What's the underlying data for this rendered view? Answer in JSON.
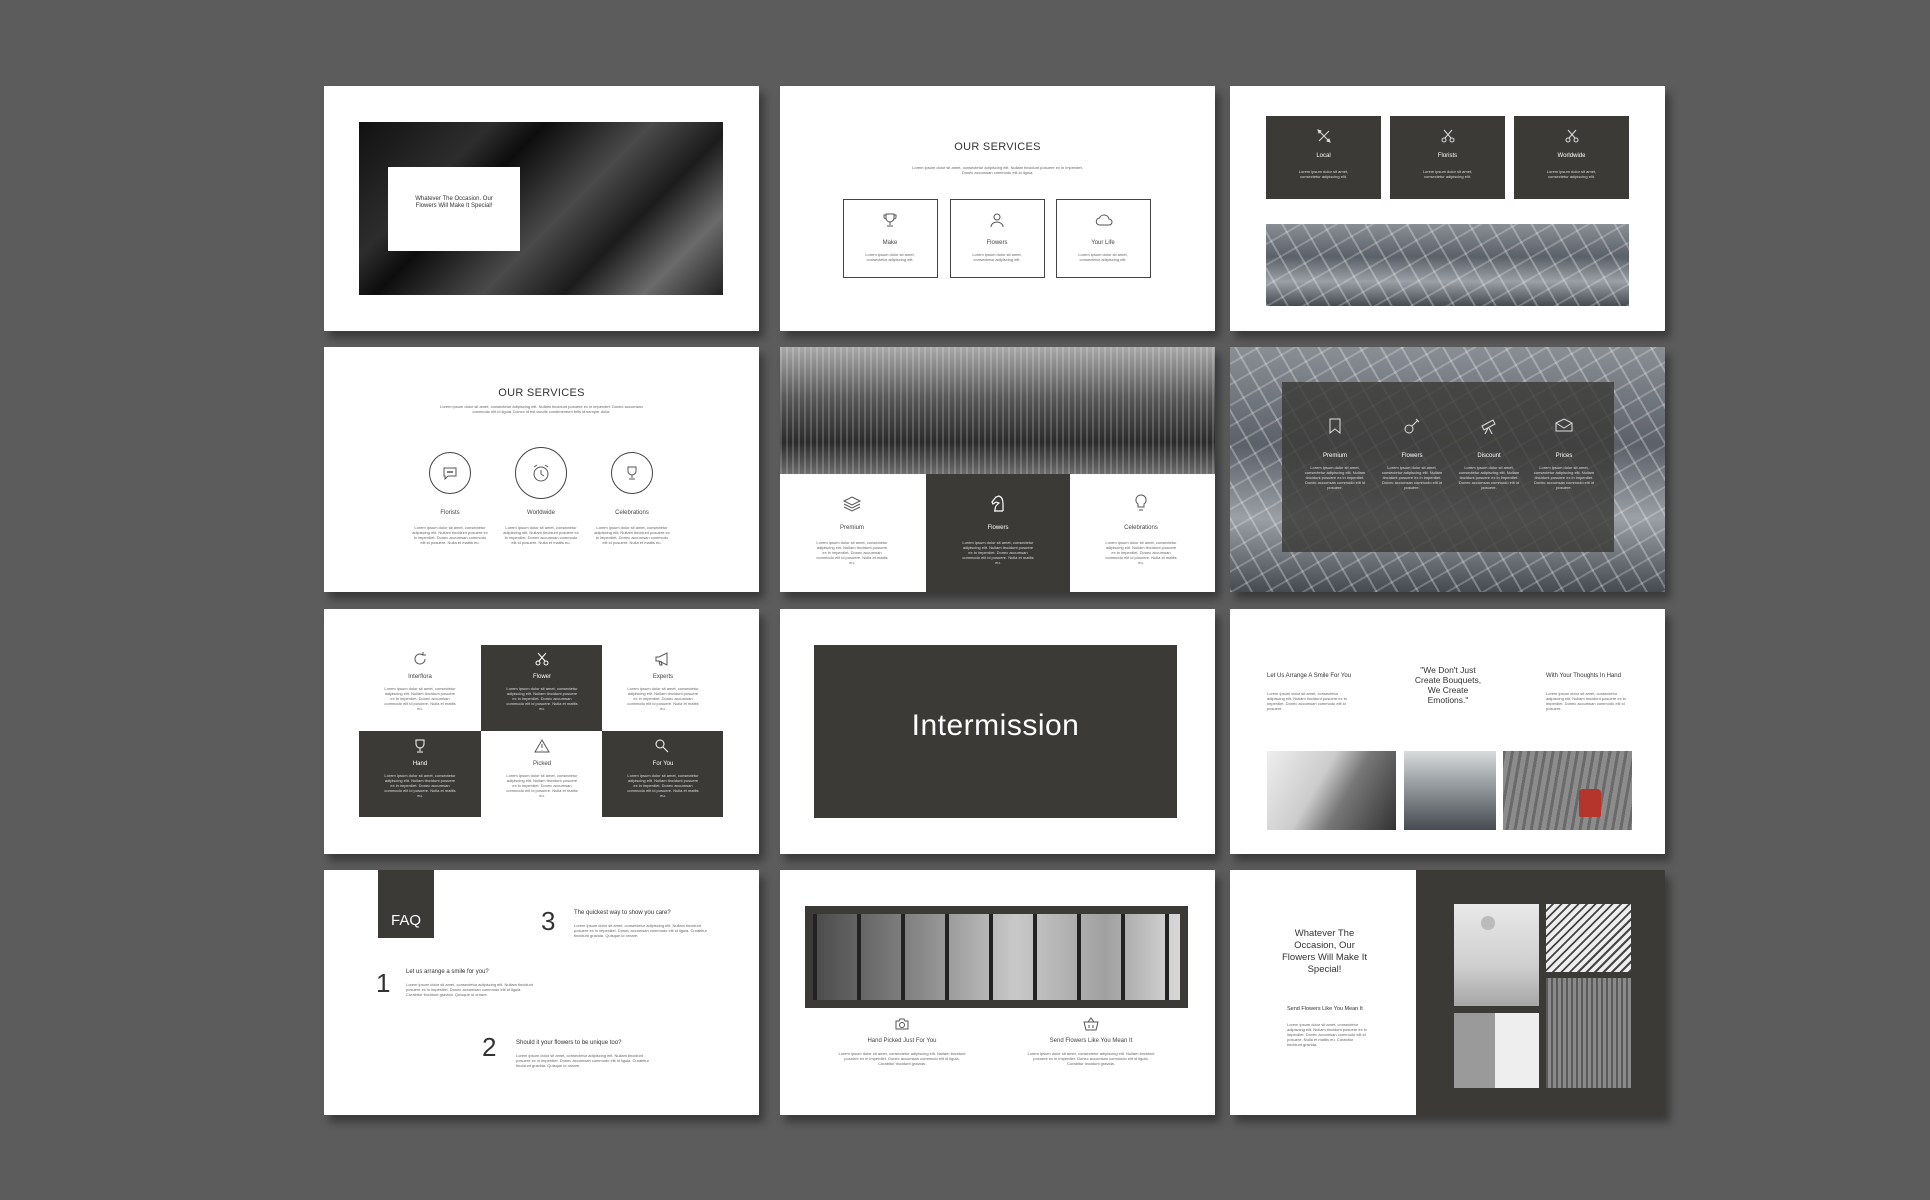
{
  "slides": {
    "s1": {
      "quote": "Whatever The Occasion. Our Flowers Will Make It Special!"
    },
    "s2": {
      "title": "OUR SERVICES",
      "intro": "Lorem ipsum dolor sit amet, consectetur adipiscing elit. Nullam tincidunt posuere ex in imperdiet. Donec accumsan commodo elit id ligula.",
      "items": [
        {
          "label": "Make",
          "text": "Lorem ipsum dolor sit amet, consectetur adipiscing elit."
        },
        {
          "label": "Flowers",
          "text": "Lorem ipsum dolor sit amet, consectetur adipiscing elit."
        },
        {
          "label": "Your Life",
          "text": "Lorem ipsum dolor sit amet, consectetur adipiscing elit."
        }
      ]
    },
    "s3": {
      "items": [
        {
          "label": "Local",
          "text": "Lorem ipsum dolor sit amet, consectetur adipiscing elit."
        },
        {
          "label": "Florists",
          "text": "Lorem ipsum dolor sit amet, consectetur adipiscing elit."
        },
        {
          "label": "Worldwide",
          "text": "Lorem ipsum dolor sit amet, consectetur adipiscing elit."
        }
      ]
    },
    "s4": {
      "title": "OUR SERVICES",
      "intro": "Lorem ipsum dolor sit amet, consectetur adipiscing elit. Nullam tincidunt posuere ex in imperdiet. Donec accumsan commodo elit id ligula. Donec id est iaculis condimentum felis id semper dolor.",
      "items": [
        {
          "label": "Florists",
          "text": "Lorem ipsum dolor sit amet, consectetur adipiscing elit. Nullam tincidunt posuere ex in imperdiet. Donec accumsan commodo elit id posuere. Nulla et mattis eu."
        },
        {
          "label": "Worldwide",
          "text": "Lorem ipsum dolor sit amet, consectetur adipiscing elit. Nullam tincidunt posuere ex in imperdiet. Donec accumsan commodo elit id posuere. Nulla et mattis eu."
        },
        {
          "label": "Celebrations",
          "text": "Lorem ipsum dolor sit amet, consectetur adipiscing elit. Nullam tincidunt posuere ex in imperdiet. Donec accumsan commodo elit id posuere. Nulla et mattis eu."
        }
      ]
    },
    "s5": {
      "items": [
        {
          "label": "Premium",
          "text": "Lorem ipsum dolor sit amet, consectetur adipiscing elit. Nullam tincidunt posuere ex in imperdiet. Donec accumsan commodo elit id posuere. Nulla et mattis eu."
        },
        {
          "label": "Flowers",
          "text": "Lorem ipsum dolor sit amet, consectetur adipiscing elit. Nullam tincidunt posuere ex in imperdiet. Donec accumsan commodo elit id posuere. Nulla et mattis eu."
        },
        {
          "label": "Celebrations",
          "text": "Lorem ipsum dolor sit amet, consectetur adipiscing elit. Nullam tincidunt posuere ex in imperdiet. Donec accumsan commodo elit id posuere. Nulla et mattis eu."
        }
      ]
    },
    "s6": {
      "items": [
        {
          "label": "Premium",
          "text": "Lorem ipsum dolor sit amet, consectetur adipiscing elit. Nullam tincidunt posuere ex in imperdiet. Donec accumsan commodo elit id posuere."
        },
        {
          "label": "Flowers",
          "text": "Lorem ipsum dolor sit amet, consectetur adipiscing elit. Nullam tincidunt posuere ex in imperdiet. Donec accumsan commodo elit id posuere."
        },
        {
          "label": "Discount",
          "text": "Lorem ipsum dolor sit amet, consectetur adipiscing elit. Nullam tincidunt posuere ex in imperdiet. Donec accumsan commodo elit id posuere."
        },
        {
          "label": "Prices",
          "text": "Lorem ipsum dolor sit amet, consectetur adipiscing elit. Nullam tincidunt posuere ex in imperdiet. Donec accumsan commodo elit id posuere."
        }
      ]
    },
    "s7": {
      "items": [
        {
          "label": "Interflora",
          "text": "Lorem ipsum dolor sit amet, consectetur adipiscing elit. Nullam tincidunt posuere ex in imperdiet. Donec accumsan commodo elit id posuere. Nulla et mattis eu."
        },
        {
          "label": "Flower",
          "text": "Lorem ipsum dolor sit amet, consectetur adipiscing elit. Nullam tincidunt posuere ex in imperdiet. Donec accumsan commodo elit id posuere. Nulla et mattis eu."
        },
        {
          "label": "Experts",
          "text": "Lorem ipsum dolor sit amet, consectetur adipiscing elit. Nullam tincidunt posuere ex in imperdiet. Donec accumsan commodo elit id posuere. Nulla et mattis eu."
        },
        {
          "label": "Hand",
          "text": "Lorem ipsum dolor sit amet, consectetur adipiscing elit. Nullam tincidunt posuere ex in imperdiet. Donec accumsan commodo elit id posuere. Nulla et mattis eu."
        },
        {
          "label": "Picked",
          "text": "Lorem ipsum dolor sit amet, consectetur adipiscing elit. Nullam tincidunt posuere ex in imperdiet. Donec accumsan commodo elit id posuere. Nulla et mattis eu."
        },
        {
          "label": "For You",
          "text": "Lorem ipsum dolor sit amet, consectetur adipiscing elit. Nullam tincidunt posuere ex in imperdiet. Donec accumsan commodo elit id posuere. Nulla et mattis eu."
        }
      ]
    },
    "s8": {
      "title": "Intermission"
    },
    "s9": {
      "left_title": "Let Us Arrange A Smile For You",
      "left_text": "Lorem ipsum dolor sit amet, consectetur adipiscing elit. Nullam tincidunt posuere ex in imperdiet. Donec accumsan commodo elit id posuere.",
      "quote": "\"We Don't Just Create Bouquets, We Create Emotions.\"",
      "right_title": "With Your Thoughts In Hand",
      "right_text": "Lorem ipsum dolor sit amet, consectetur adipiscing elit. Nullam tincidunt posuere ex in imperdiet. Donec accumsan commodo elit id posuere."
    },
    "s10": {
      "badge": "FAQ",
      "items": [
        {
          "num": "1",
          "q": "Let us arrange a smile for you?",
          "a": "Lorem ipsum dolor sit amet, consectetur adipiscing elit. Nullam tincidunt posuere ex in imperdiet. Donec accumsan commodo elit id ligula. Curabitur tincidunt gravida. Quisque id ornare."
        },
        {
          "num": "2",
          "q": "Should it your flowers to be unique too?",
          "a": "Lorem ipsum dolor sit amet, consectetur adipiscing elit. Nullam tincidunt posuere ex in imperdiet. Donec accumsan commodo elit id ligula. Curabitur tincidunt gravida. Quisque id ornare."
        },
        {
          "num": "3",
          "q": "The quickest way to show you care?",
          "a": "Lorem ipsum dolor sit amet, consectetur adipiscing elit. Nullam tincidunt posuere ex in imperdiet. Donec accumsan commodo elit id ligula. Curabitur tincidunt gravida. Quisque id ornare."
        }
      ]
    },
    "s11": {
      "items": [
        {
          "label": "Hand Picked Just For You",
          "text": "Lorem ipsum dolor sit amet, consectetur adipiscing elit. Nullam tincidunt posuere ex in imperdiet. Donec accumsan commodo elit id ligula. Curabitur tincidunt gravida."
        },
        {
          "label": "Send Flowers Like You Mean It",
          "text": "Lorem ipsum dolor sit amet, consectetur adipiscing elit. Nullam tincidunt posuere ex in imperdiet. Donec accumsan commodo elit id ligula. Curabitur tincidunt gravida."
        }
      ]
    },
    "s12": {
      "title": "Whatever The Occasion, Our Flowers Will Make It Special!",
      "subtitle": "Send Flowers Like You Mean It",
      "text": "Lorem ipsum dolor sit amet, consectetur adipiscing elit. Nullam tincidunt posuere ex in imperdiet. Donec accumsan commodo elit id posuere. Nulla et mattis eu. Curabitur tincidunt gravida."
    }
  }
}
